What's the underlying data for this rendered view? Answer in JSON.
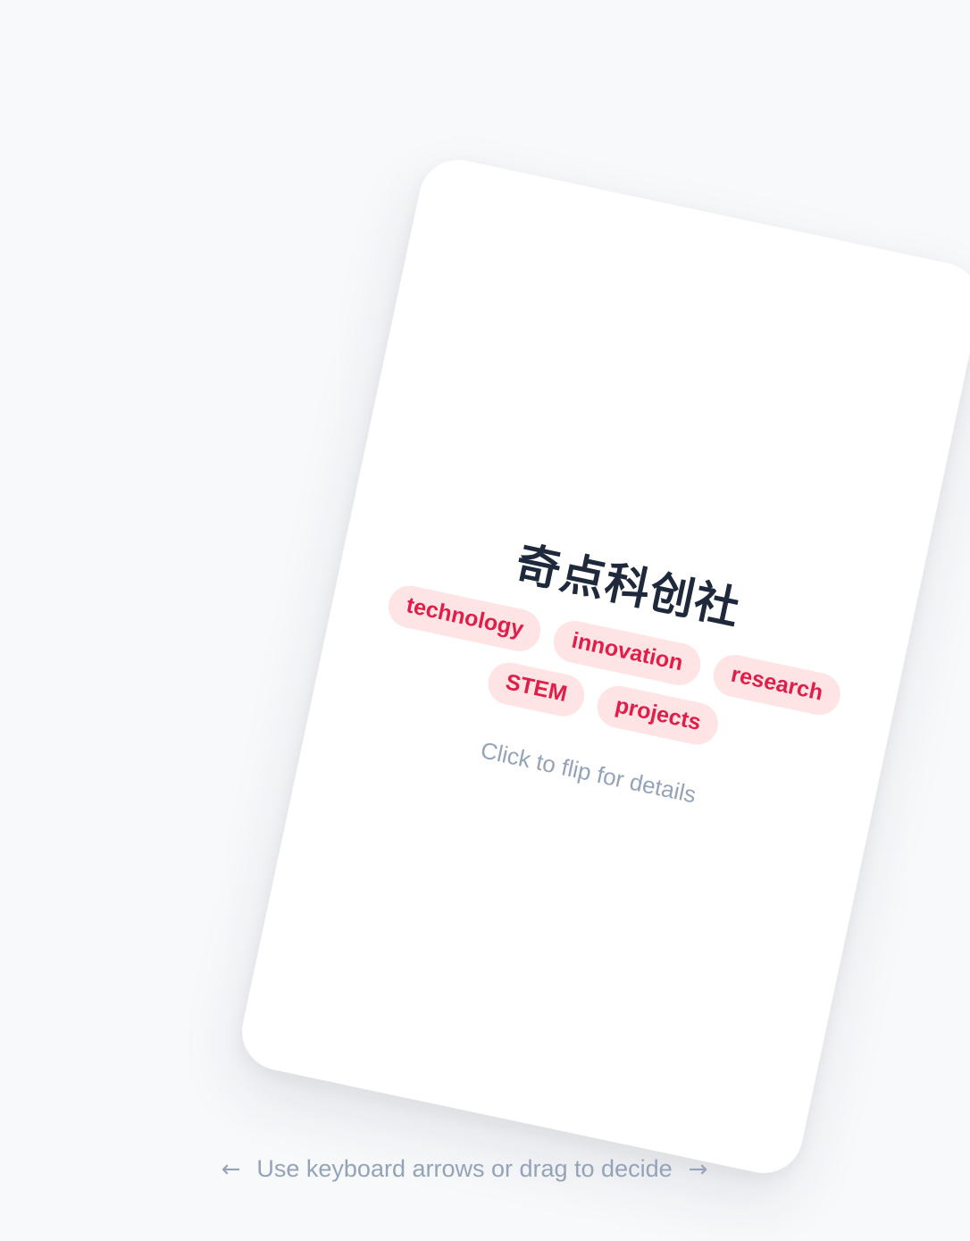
{
  "card": {
    "title": "奇点科创社",
    "tags": [
      "technology",
      "innovation",
      "research",
      "STEM",
      "projects"
    ],
    "hint": "Click to flip for details"
  },
  "footer": {
    "left_arrow": "←",
    "instruction": "Use keyboard arrows or drag to decide",
    "right_arrow": "→"
  },
  "colors": {
    "background": "#f8f9fb",
    "card": "#ffffff",
    "title": "#1e293b",
    "tag_bg": "#ffe4e6",
    "tag_text": "#e11d48",
    "muted_text": "#94a3b8"
  },
  "icons": {
    "left": "arrow-left-icon",
    "right": "arrow-right-icon"
  }
}
